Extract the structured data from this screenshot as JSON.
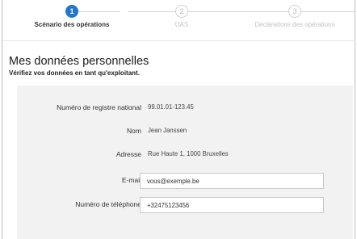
{
  "stepper": {
    "steps": [
      {
        "number": "1",
        "label": "Scénario des opérations",
        "state": "active"
      },
      {
        "number": "2",
        "label": "UAS",
        "state": "inactive"
      },
      {
        "number": "3",
        "label": "Déclarations des opérations",
        "state": "inactive"
      }
    ],
    "active_color": "#1f78c8"
  },
  "page": {
    "title": "Mes données personnelles",
    "subtitle": "Vérifiez vos données en tant qu'exploitant."
  },
  "form": {
    "national_register": {
      "label": "Numéro de registre national",
      "value": "99.01.01-123.45"
    },
    "name": {
      "label": "Nom",
      "value": "Jean Janssen"
    },
    "address": {
      "label": "Adresse",
      "value": "Rue Haute 1, 1000 Bruxelles"
    },
    "email": {
      "label": "E-mail",
      "value": "vous@exemple.be"
    },
    "phone": {
      "label": "Numéro de téléphone",
      "value": "+32475123456"
    }
  }
}
